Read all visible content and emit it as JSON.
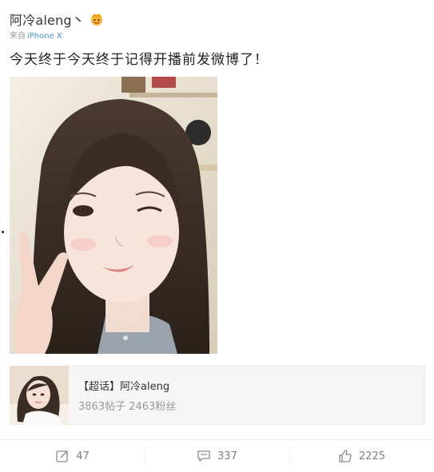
{
  "post": {
    "author": "阿冷aleng丶",
    "source_prefix": "来自",
    "source_device": "iPhone X",
    "text": "今天终于今天终于记得开播前发微博了！",
    "photo_icon": "selfie-photo"
  },
  "topic": {
    "title": "【超话】阿冷aleng",
    "stats": "3863帖子 2463粉丝"
  },
  "actions": {
    "repost_count": "47",
    "comment_count": "337",
    "like_count": "2225"
  },
  "colors": {
    "link": "#4a8fd1",
    "muted": "#999999",
    "text": "#333333"
  }
}
